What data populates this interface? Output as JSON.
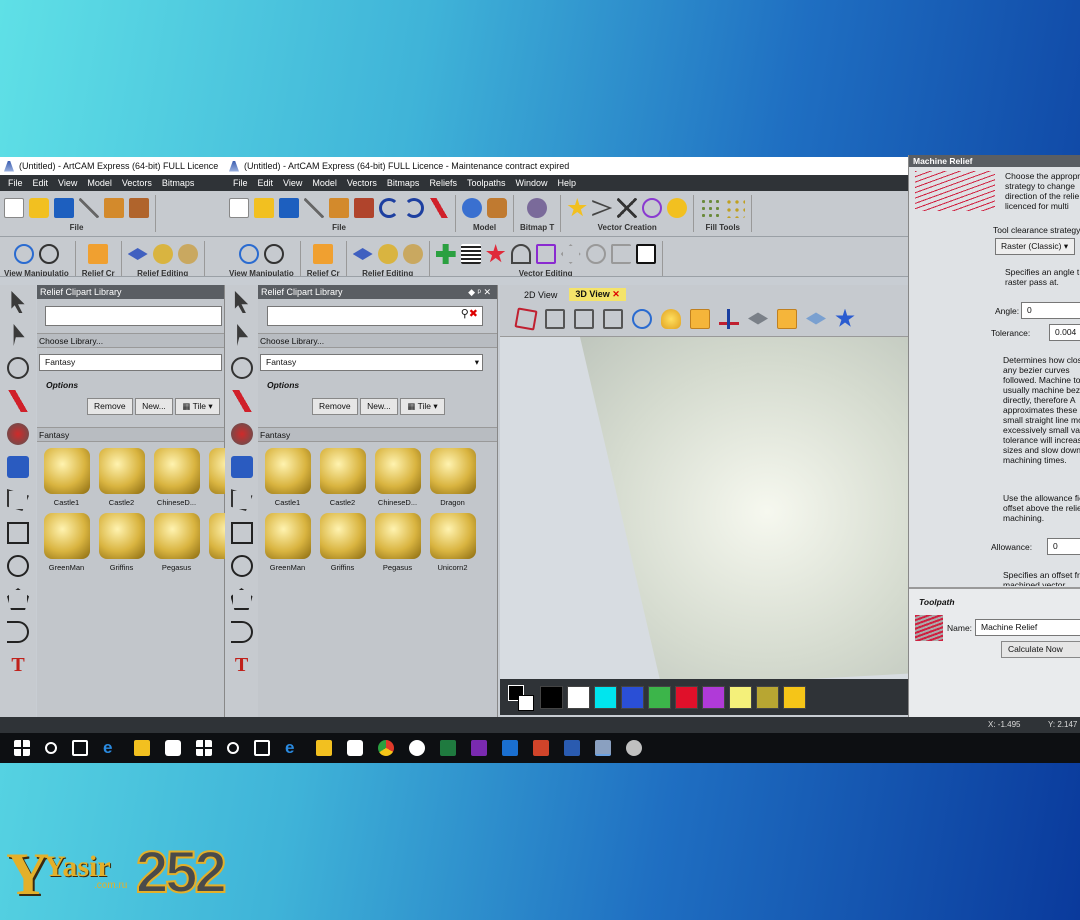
{
  "win1": {
    "title": "(Untitled) - ArtCAM Express (64-bit) FULL Licence",
    "menu": [
      "File",
      "Edit",
      "View",
      "Model",
      "Vectors",
      "Bitmaps"
    ],
    "groups": [
      "File",
      "View Manipulatio",
      "Relief Cr",
      "Relief Editing"
    ],
    "clipart": {
      "header": "Relief Clipart Library",
      "choose": "Choose Library...",
      "library": "Fantasy",
      "options": "Options",
      "remove": "Remove",
      "new": "New...",
      "tile": "Tile",
      "section": "Fantasy",
      "items": [
        "Castle1",
        "Castle2",
        "ChineseD...",
        "Dr",
        "GreenMan",
        "Griffins",
        "Pegasus",
        "Un"
      ]
    }
  },
  "win2": {
    "title": "(Untitled) - ArtCAM Express (64-bit) FULL Licence - Maintenance contract expired",
    "menu": [
      "File",
      "Edit",
      "View",
      "Model",
      "Vectors",
      "Bitmaps",
      "Reliefs",
      "Toolpaths",
      "Window",
      "Help"
    ],
    "groups": [
      "File",
      "Model",
      "Bitmap T",
      "Vector Creation",
      "Fill Tools",
      "View Manipulatio",
      "Relief Cr",
      "Relief Editing",
      "Vector Editing"
    ],
    "clipart": {
      "header": "Relief Clipart Library",
      "choose": "Choose Library...",
      "library": "Fantasy",
      "options": "Options",
      "remove": "Remove",
      "new": "New...",
      "tile": "Tile",
      "section": "Fantasy",
      "items": [
        "Castle1",
        "Castle2",
        "ChineseD...",
        "Dragon",
        "GreenMan",
        "Griffins",
        "Pegasus",
        "Unicorn2"
      ]
    },
    "tabs": [
      "2D View",
      "3D View"
    ],
    "palette": [
      "#000000",
      "#ffffff",
      "#00e5ee",
      "#2a4fd6",
      "#3cb54a",
      "#e0102a",
      "#b03ad8",
      "#f4f07a",
      "#b8a632",
      "#f5c518"
    ],
    "coords": {
      "x": "X: -1.495",
      "y": "Y: 2.147"
    }
  },
  "machine": {
    "title": "Machine Relief",
    "intro": "Choose the appropr strategy to change direction of the relie be licenced for multi",
    "strategy_label": "Tool clearance strategy",
    "strategy": "Raster (Classic)",
    "angle_help": "Specifies an angle t raster pass at.",
    "angle_label": "Angle:",
    "angle": "0",
    "tol_label": "Tolerance:",
    "tol": "0.004",
    "tol_help": "Determines how clos of any bezier curves followed. Machine to usually machine bezie directly, therefore A approximates these small straight line mo excessively small val tolerance will increas sizes and slow down machining times.",
    "allow_help": "Use the allowance fie offset above the relie machining.",
    "allow_label": "Allowance:",
    "allow": "0",
    "offset_help": "Specifies an offset fr machined vector.",
    "toolpath": "Toolpath",
    "name_label": "Name:",
    "name": "Machine Relief",
    "calc": "Calculate Now"
  },
  "logo": {
    "main": "Yasir",
    "num": "252",
    "sub": ".com.ru"
  }
}
